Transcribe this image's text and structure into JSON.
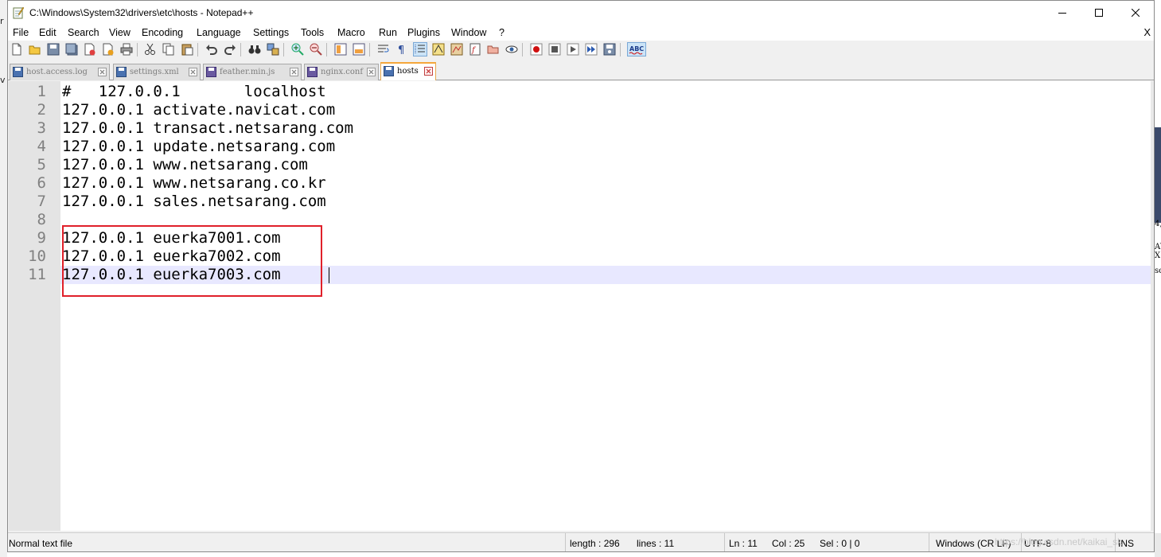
{
  "window": {
    "title": "C:\\Windows\\System32\\drivers\\etc\\hosts - Notepad++"
  },
  "menu": {
    "items": [
      "File",
      "Edit",
      "Search",
      "View",
      "Encoding",
      "Language",
      "Settings",
      "Tools",
      "Macro",
      "Run",
      "Plugins",
      "Window",
      "?"
    ],
    "close_doc": "X"
  },
  "tabs": [
    {
      "label": "host.access.log",
      "active": false
    },
    {
      "label": "settings.xml",
      "active": false
    },
    {
      "label": "feather.min.js",
      "active": false
    },
    {
      "label": "nginx.conf",
      "active": false
    },
    {
      "label": "hosts",
      "active": true
    }
  ],
  "editor": {
    "line_numbers": [
      "1",
      "2",
      "3",
      "4",
      "5",
      "6",
      "7",
      "8",
      "9",
      "10",
      "11"
    ],
    "lines": [
      "#   127.0.0.1       localhost",
      "127.0.0.1 activate.navicat.com",
      "127.0.0.1 transact.netsarang.com",
      "127.0.0.1 update.netsarang.com",
      "127.0.0.1 www.netsarang.com",
      "127.0.0.1 www.netsarang.co.kr",
      "127.0.0.1 sales.netsarang.com",
      "",
      "127.0.0.1 euerka7001.com",
      "127.0.0.1 euerka7002.com",
      "127.0.0.1 euerka7003.com"
    ],
    "current_line": 11
  },
  "status": {
    "file_type": "Normal text file",
    "length": "length : 296",
    "lines": "lines : 11",
    "ln": "Ln : 11",
    "col": "Col : 25",
    "sel": "Sel : 0 | 0",
    "eol": "Windows (CR LF)",
    "encoding": "UTF-8",
    "mode": "INS",
    "watermark": "https://blog.csdn.net/kaikai_sk"
  },
  "background": {
    "left_fragments": [
      "r",
      "v"
    ],
    "right_fragments": [
      "4,",
      "AY",
      "X",
      "so"
    ]
  },
  "colors": {
    "annotation_box": "#e0202a",
    "current_line": "#e8e8ff",
    "active_tab_accent": "#f5a73b",
    "gutter": "#e4e4e4"
  }
}
